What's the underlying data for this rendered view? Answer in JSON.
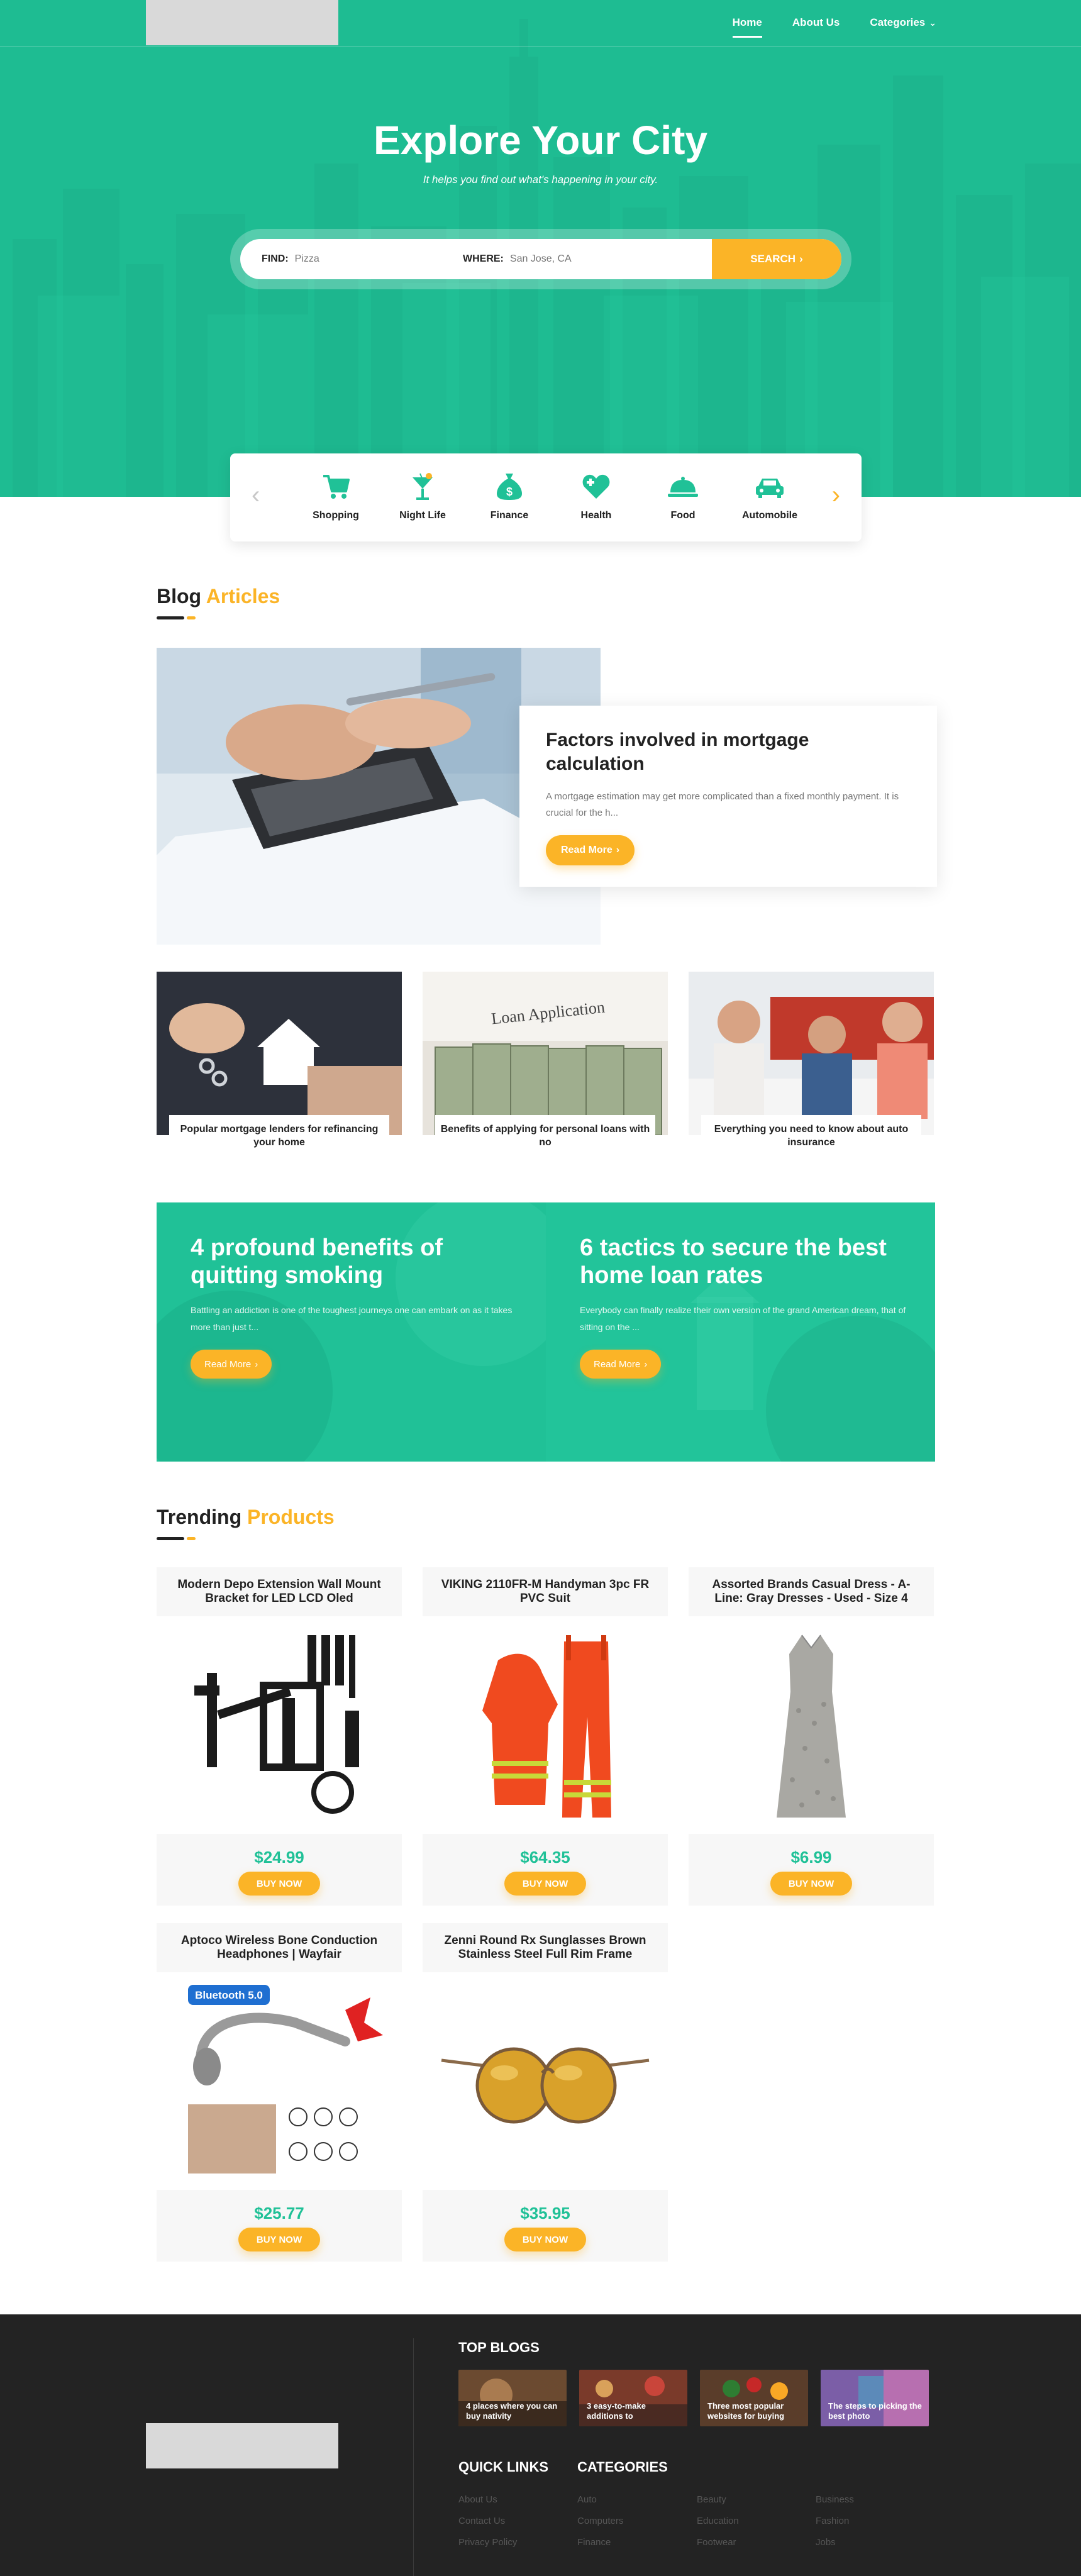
{
  "header": {
    "nav": [
      "Home",
      "About Us",
      "Categories"
    ]
  },
  "hero": {
    "title": "Explore Your City",
    "subtitle": "It helps you find out what's happening in your city.",
    "search": {
      "find_label": "FIND:",
      "find_placeholder": "Pizza",
      "where_label": "WHERE:",
      "where_placeholder": "San Jose, CA",
      "button_label": "SEARCH"
    }
  },
  "categories": [
    "Shopping",
    "Night Life",
    "Finance",
    "Health",
    "Food",
    "Automobile"
  ],
  "blog": {
    "heading_main": "Blog",
    "heading_accent": "Articles",
    "featured": {
      "title": "Factors involved in mortgage calculation",
      "excerpt": "A mortgage estimation may get more complicated than a fixed monthly payment. It is crucial for the h...",
      "button_label": "Read More"
    },
    "small_articles": [
      "Popular mortgage lenders for refinancing your home",
      "Benefits of applying for personal loans with no",
      "Everything you need to know about auto insurance"
    ],
    "loan_sign": "Loan Application",
    "banners": [
      {
        "title": "4 profound benefits of quitting smoking",
        "excerpt": "Battling an addiction is one of the toughest journeys one can embark on as it takes more than just t...",
        "button_label": "Read More"
      },
      {
        "title": "6 tactics to secure the best home loan rates",
        "excerpt": "Everybody can finally realize their own version of the grand American dream, that of sitting on the ...",
        "button_label": "Read More"
      }
    ]
  },
  "products": {
    "heading_main": "Trending",
    "heading_accent": "Products",
    "buy_label": "BUY NOW",
    "items": [
      {
        "title": "Modern Depo Extension Wall Mount Bracket for LED LCD Oled",
        "price": "$24.99"
      },
      {
        "title": "VIKING 2110FR-M Handyman 3pc FR PVC Suit",
        "price": "$64.35"
      },
      {
        "title": "Assorted Brands Casual Dress - A-Line: Gray Dresses - Used - Size 4",
        "price": "$6.99"
      },
      {
        "title": "Aptoco Wireless Bone Conduction Headphones | Wayfair",
        "price": "$25.77"
      },
      {
        "title": "Zenni Round Rx Sunglasses Brown Stainless Steel Full Rim Frame",
        "price": "$35.95"
      }
    ],
    "headphone_badge": "Bluetooth 5.0"
  },
  "footer": {
    "top_blogs_heading": "TOP BLOGS",
    "top_blogs": [
      "4 places where you can buy nativity",
      "3 easy-to-make additions to",
      "Three most popular websites for buying",
      "The steps to picking the best photo"
    ],
    "quick_links_heading": "QUICK LINKS",
    "categories_heading": "CATEGORIES",
    "quick_links": [
      "About Us",
      "Contact Us",
      "Privacy Policy"
    ],
    "category_cols": [
      [
        "Auto",
        "Computers",
        "Finance"
      ],
      [
        "Beauty",
        "Education",
        "Footwear"
      ],
      [
        "Business",
        "Fashion",
        "Jobs"
      ]
    ]
  },
  "colors": {
    "primary_green": "#20c197",
    "accent_yellow": "#fbb427",
    "footer_bg": "#232323"
  }
}
